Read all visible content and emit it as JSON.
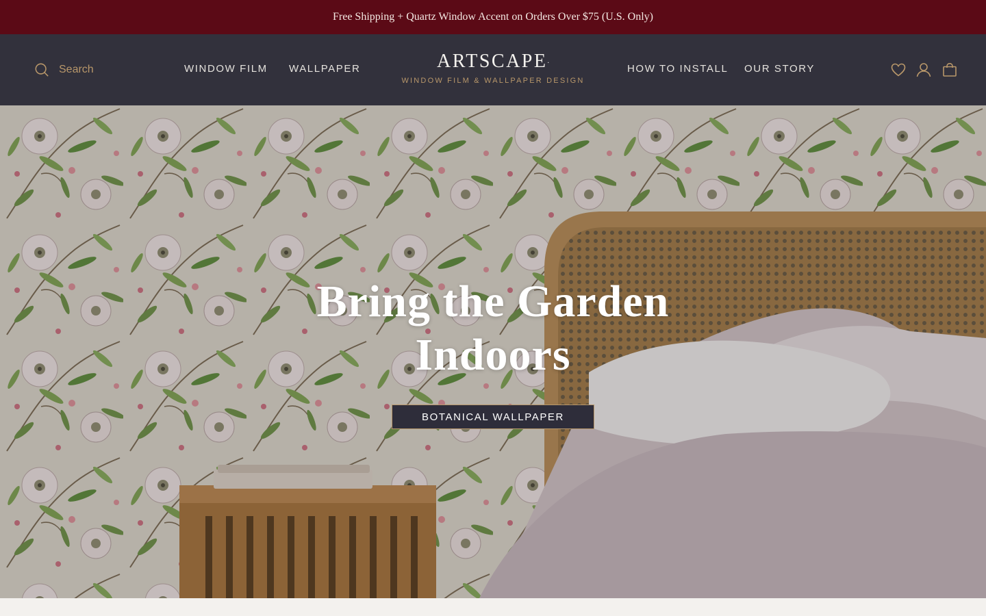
{
  "announcement": {
    "text": "Free Shipping + Quartz Window Accent on Orders Over $75 (U.S. Only)"
  },
  "header": {
    "search_label": "Search",
    "nav_left": [
      "WINDOW FILM",
      "WALLPAPER"
    ],
    "nav_right": [
      "HOW TO INSTALL",
      "OUR STORY"
    ],
    "logo": {
      "wordmark": "ARTSCAPE",
      "registered": ".",
      "tagline": "WINDOW FILM & WALLPAPER DESIGN"
    },
    "icons": [
      "search-icon",
      "heart-icon",
      "account-icon",
      "bag-icon"
    ]
  },
  "hero": {
    "title_line1": "Bring the Garden",
    "title_line2": "Indoors",
    "button_label": "BOTANICAL WALLPAPER"
  },
  "colors": {
    "announcement_bg": "#5b0a16",
    "header_bg": "#32313c",
    "accent_gold": "#b8976a",
    "button_bg": "#2e2d3a"
  }
}
